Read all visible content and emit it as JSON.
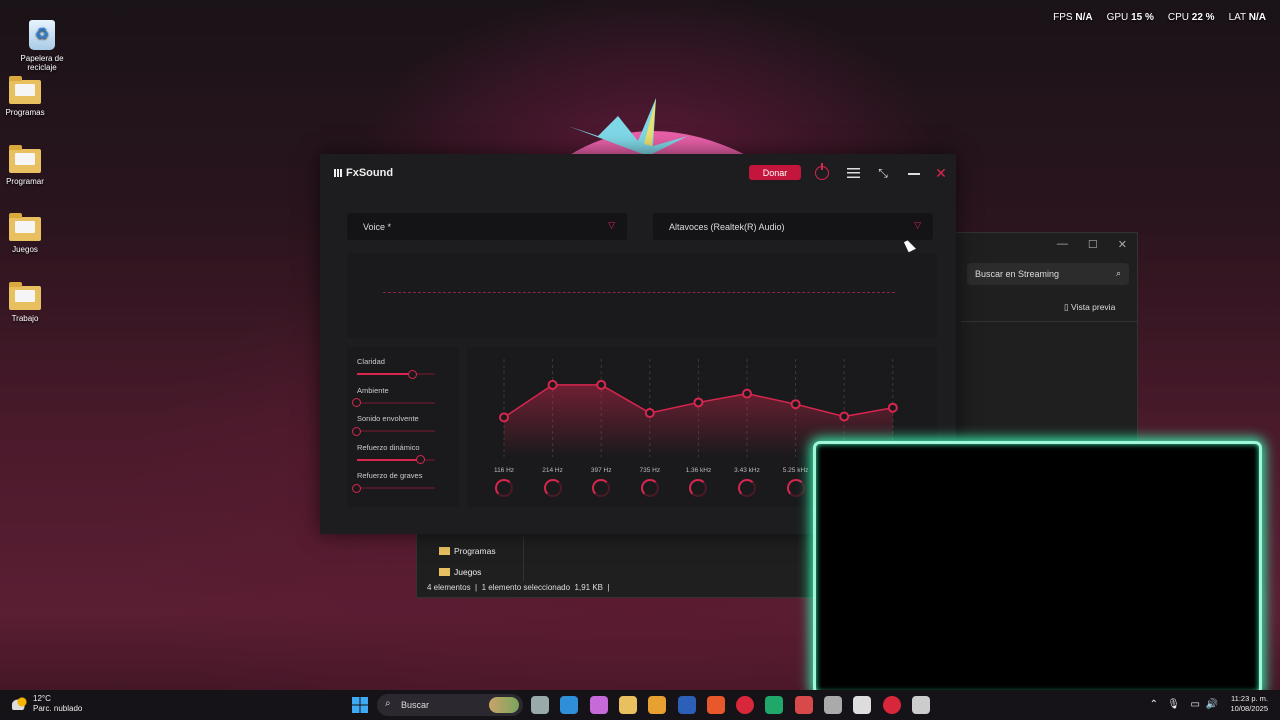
{
  "overlay": {
    "fps_label": "FPS",
    "fps_value": "N/A",
    "gpu_label": "GPU",
    "gpu_value": "15 %",
    "cpu_label": "CPU",
    "cpu_value": "22 %",
    "lat_label": "LAT",
    "lat_value": "N/A"
  },
  "desktop": {
    "icons": [
      {
        "label": "Papelera de reciclaje",
        "icon": "recycle-bin-icon"
      },
      {
        "label": "Programas",
        "icon": "folder-icon"
      },
      {
        "label": "Programar",
        "icon": "folder-icon"
      },
      {
        "label": "Juegos",
        "icon": "folder-icon"
      },
      {
        "label": "Trabajo",
        "icon": "folder-icon"
      }
    ]
  },
  "explorer": {
    "search_placeholder": "Buscar en Streaming",
    "preview_label": "Vista previa",
    "nav": [
      "Programas",
      "Juegos"
    ],
    "status": {
      "count": "4 elementos",
      "selected": "1 elemento seleccionado",
      "size": "1,91 KB"
    }
  },
  "fxsound": {
    "logo": "FxSound",
    "donate_label": "Donar",
    "preset": "Voice *",
    "output_device": "Altavoces (Realtek(R) Audio)",
    "effects": [
      {
        "label": "Claridad",
        "value": 0.72
      },
      {
        "label": "Ambiente",
        "value": 0.0
      },
      {
        "label": "Sonido envolvente",
        "value": 0.0
      },
      {
        "label": "Refuerzo dinámico",
        "value": 0.82
      },
      {
        "label": "Refuerzo de graves",
        "value": 0.0
      }
    ],
    "eq_bands": [
      {
        "freq": "116 Hz",
        "gain": 0.45
      },
      {
        "freq": "214 Hz",
        "gain": 0.82
      },
      {
        "freq": "397 Hz",
        "gain": 0.82
      },
      {
        "freq": "735 Hz",
        "gain": 0.5
      },
      {
        "freq": "1.36 kHz",
        "gain": 0.62
      },
      {
        "freq": "3.43 kHz",
        "gain": 0.72
      },
      {
        "freq": "5.25 kHz",
        "gain": 0.6
      },
      {
        "freq": "",
        "gain": 0.46
      },
      {
        "freq": "",
        "gain": 0.56
      }
    ],
    "accent": "#d8264f"
  },
  "taskbar": {
    "weather_temp": "12°C",
    "weather_desc": "Parc. nublado",
    "search_label": "Buscar",
    "time": "11:23 p. m.",
    "date": "10/08/2025",
    "apps": [
      "task-view-icon",
      "edge-icon",
      "copilot-icon",
      "file-explorer-icon",
      "chrome-icon",
      "word-icon",
      "brave-icon",
      "opera-gx-icon",
      "whatsapp-icon",
      "microphone-icon",
      "steam-icon",
      "fxsound-taskbar-icon",
      "opera-icon",
      "task-manager-icon"
    ]
  }
}
